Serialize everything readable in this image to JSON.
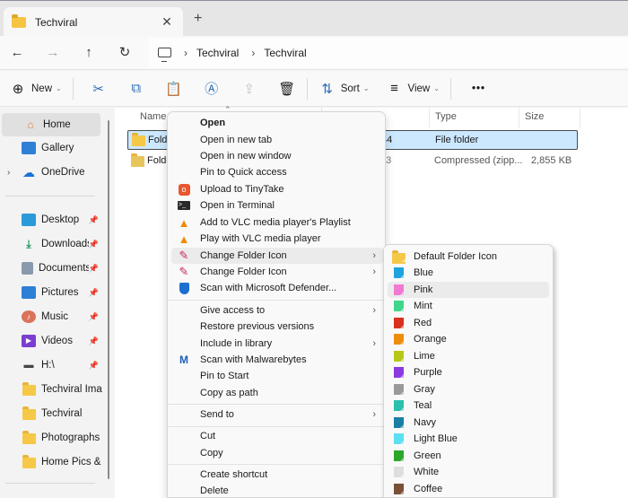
{
  "window": {
    "tab_title": "Techviral",
    "tab_close": "✕",
    "new_tab": "+"
  },
  "nav": {
    "back": "←",
    "forward": "→",
    "up": "↑",
    "refresh": "↻",
    "breadcrumb": [
      "Techviral",
      "Techviral"
    ],
    "sep": "›"
  },
  "commands": {
    "new_label": "New",
    "sort_label": "Sort",
    "view_label": "View",
    "more_label": "•••",
    "caret": "⌄"
  },
  "sidebar": {
    "top": [
      {
        "label": "Home",
        "icon": "home-icon",
        "selected": true
      },
      {
        "label": "Gallery",
        "icon": "gallery-icon"
      },
      {
        "label": "OneDrive",
        "icon": "onedrive-icon",
        "expandable": true
      }
    ],
    "quick": [
      {
        "label": "Desktop",
        "icon": "desktop-icon",
        "pinned": true
      },
      {
        "label": "Downloads",
        "icon": "downloads-icon",
        "pinned": true
      },
      {
        "label": "Documents",
        "icon": "documents-icon",
        "pinned": true
      },
      {
        "label": "Pictures",
        "icon": "pictures-icon",
        "pinned": true
      },
      {
        "label": "Music",
        "icon": "music-icon",
        "pinned": true
      },
      {
        "label": "Videos",
        "icon": "videos-icon",
        "pinned": true
      },
      {
        "label": "H:\\",
        "icon": "drive-icon",
        "pinned": true
      },
      {
        "label": "Techviral Images",
        "icon": "folder-icon"
      },
      {
        "label": "Techviral",
        "icon": "folder-icon"
      },
      {
        "label": "Photographs",
        "icon": "folder-icon"
      },
      {
        "label": "Home Pics & Tc",
        "icon": "folder-icon"
      }
    ],
    "pin_glyph": "📌",
    "expand_glyph": "›"
  },
  "files": {
    "columns": {
      "name": "Name",
      "type": "Type",
      "size": "Size"
    },
    "rows": [
      {
        "name": "Folde",
        "date_fragment": "44",
        "type": "File folder",
        "size": "",
        "selected": true
      },
      {
        "name": "Folde",
        "date_fragment": "43",
        "type": "Compressed (zipp...",
        "size": "2,855 KB",
        "selected": false
      }
    ]
  },
  "context_menu": {
    "items": [
      {
        "label": "Open",
        "bold": true
      },
      {
        "label": "Open in new tab"
      },
      {
        "label": "Open in new window"
      },
      {
        "label": "Pin to Quick access"
      },
      {
        "label": "Upload to TinyTake",
        "icon": "tinytake-icon"
      },
      {
        "label": "Open in Terminal",
        "icon": "terminal-icon"
      },
      {
        "label": "Add to VLC media player's Playlist",
        "icon": "vlc-icon"
      },
      {
        "label": "Play with VLC media player",
        "icon": "vlc-icon"
      },
      {
        "label": "Change Folder Icon",
        "icon": "brush-icon",
        "submenu": true,
        "hover": true
      },
      {
        "label": "Change Folder Icon",
        "icon": "brush-icon",
        "submenu": true
      },
      {
        "label": "Scan with Microsoft Defender...",
        "icon": "defender-icon"
      },
      {
        "label": "Give access to",
        "submenu": true
      },
      {
        "label": "Restore previous versions"
      },
      {
        "label": "Include in library",
        "submenu": true
      },
      {
        "label": "Scan with Malwarebytes",
        "icon": "malwarebytes-icon"
      },
      {
        "label": "Pin to Start"
      },
      {
        "label": "Copy as path"
      },
      {
        "label": "Send to",
        "submenu": true
      },
      {
        "label": "Cut"
      },
      {
        "label": "Copy"
      },
      {
        "label": "Create shortcut"
      },
      {
        "label": "Delete"
      }
    ],
    "arrow": "›"
  },
  "color_submenu": {
    "items": [
      {
        "label": "Default Folder Icon",
        "color": "#f6c847",
        "folder": true
      },
      {
        "label": "Blue",
        "color": "#1fa3dd"
      },
      {
        "label": "Pink",
        "color": "#f07ad3",
        "hover": true
      },
      {
        "label": "Mint",
        "color": "#3fd68c"
      },
      {
        "label": "Red",
        "color": "#d9301f"
      },
      {
        "label": "Orange",
        "color": "#ee8d0e"
      },
      {
        "label": "Lime",
        "color": "#b6c81a"
      },
      {
        "label": "Purple",
        "color": "#8a3ae0"
      },
      {
        "label": "Gray",
        "color": "#9a9a9a"
      },
      {
        "label": "Teal",
        "color": "#2cbfad"
      },
      {
        "label": "Navy",
        "color": "#1a7fa5"
      },
      {
        "label": "Light Blue",
        "color": "#5ae0f0"
      },
      {
        "label": "Green",
        "color": "#2ca72c"
      },
      {
        "label": "White",
        "color": "#dedede"
      },
      {
        "label": "Coffee",
        "color": "#7a5038"
      }
    ]
  }
}
